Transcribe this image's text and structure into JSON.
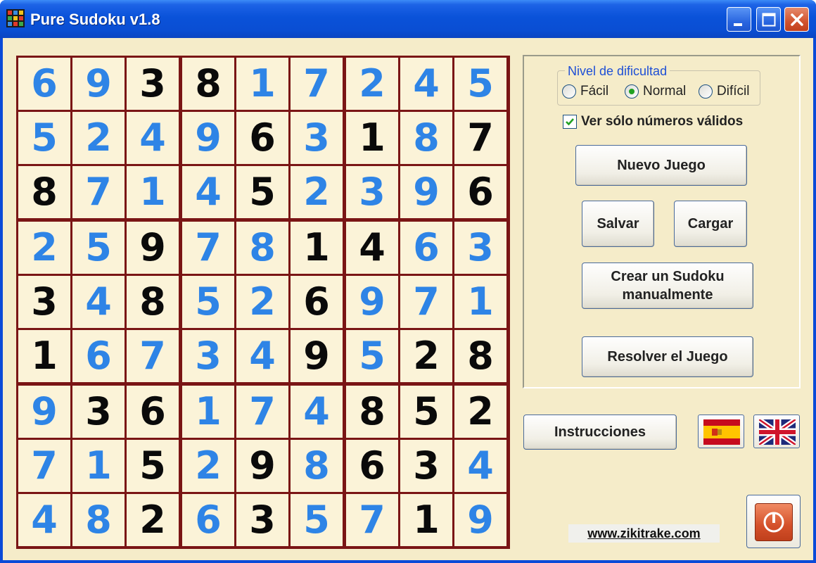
{
  "window": {
    "title": "Pure Sudoku v1.8"
  },
  "board": {
    "rows": [
      [
        {
          "v": "6",
          "c": "blue"
        },
        {
          "v": "9",
          "c": "blue"
        },
        {
          "v": "3",
          "c": "black"
        },
        {
          "v": "8",
          "c": "black"
        },
        {
          "v": "1",
          "c": "blue"
        },
        {
          "v": "7",
          "c": "blue"
        },
        {
          "v": "2",
          "c": "blue"
        },
        {
          "v": "4",
          "c": "blue"
        },
        {
          "v": "5",
          "c": "blue"
        }
      ],
      [
        {
          "v": "5",
          "c": "blue"
        },
        {
          "v": "2",
          "c": "blue"
        },
        {
          "v": "4",
          "c": "blue"
        },
        {
          "v": "9",
          "c": "blue"
        },
        {
          "v": "6",
          "c": "black"
        },
        {
          "v": "3",
          "c": "blue"
        },
        {
          "v": "1",
          "c": "black"
        },
        {
          "v": "8",
          "c": "blue"
        },
        {
          "v": "7",
          "c": "black"
        }
      ],
      [
        {
          "v": "8",
          "c": "black"
        },
        {
          "v": "7",
          "c": "blue"
        },
        {
          "v": "1",
          "c": "blue"
        },
        {
          "v": "4",
          "c": "blue"
        },
        {
          "v": "5",
          "c": "black"
        },
        {
          "v": "2",
          "c": "blue"
        },
        {
          "v": "3",
          "c": "blue"
        },
        {
          "v": "9",
          "c": "blue"
        },
        {
          "v": "6",
          "c": "black"
        }
      ],
      [
        {
          "v": "2",
          "c": "blue"
        },
        {
          "v": "5",
          "c": "blue"
        },
        {
          "v": "9",
          "c": "black"
        },
        {
          "v": "7",
          "c": "blue"
        },
        {
          "v": "8",
          "c": "blue"
        },
        {
          "v": "1",
          "c": "black"
        },
        {
          "v": "4",
          "c": "black"
        },
        {
          "v": "6",
          "c": "blue"
        },
        {
          "v": "3",
          "c": "blue"
        }
      ],
      [
        {
          "v": "3",
          "c": "black"
        },
        {
          "v": "4",
          "c": "blue"
        },
        {
          "v": "8",
          "c": "black"
        },
        {
          "v": "5",
          "c": "blue"
        },
        {
          "v": "2",
          "c": "blue"
        },
        {
          "v": "6",
          "c": "black"
        },
        {
          "v": "9",
          "c": "blue"
        },
        {
          "v": "7",
          "c": "blue"
        },
        {
          "v": "1",
          "c": "blue"
        }
      ],
      [
        {
          "v": "1",
          "c": "black"
        },
        {
          "v": "6",
          "c": "blue"
        },
        {
          "v": "7",
          "c": "blue"
        },
        {
          "v": "3",
          "c": "blue"
        },
        {
          "v": "4",
          "c": "blue"
        },
        {
          "v": "9",
          "c": "black"
        },
        {
          "v": "5",
          "c": "blue"
        },
        {
          "v": "2",
          "c": "black"
        },
        {
          "v": "8",
          "c": "black"
        }
      ],
      [
        {
          "v": "9",
          "c": "blue"
        },
        {
          "v": "3",
          "c": "black"
        },
        {
          "v": "6",
          "c": "black"
        },
        {
          "v": "1",
          "c": "blue"
        },
        {
          "v": "7",
          "c": "blue"
        },
        {
          "v": "4",
          "c": "blue"
        },
        {
          "v": "8",
          "c": "black"
        },
        {
          "v": "5",
          "c": "black"
        },
        {
          "v": "2",
          "c": "black"
        }
      ],
      [
        {
          "v": "7",
          "c": "blue"
        },
        {
          "v": "1",
          "c": "blue"
        },
        {
          "v": "5",
          "c": "black"
        },
        {
          "v": "2",
          "c": "blue"
        },
        {
          "v": "9",
          "c": "black"
        },
        {
          "v": "8",
          "c": "blue"
        },
        {
          "v": "6",
          "c": "black"
        },
        {
          "v": "3",
          "c": "black"
        },
        {
          "v": "4",
          "c": "blue"
        }
      ],
      [
        {
          "v": "4",
          "c": "blue"
        },
        {
          "v": "8",
          "c": "blue"
        },
        {
          "v": "2",
          "c": "black"
        },
        {
          "v": "6",
          "c": "blue"
        },
        {
          "v": "3",
          "c": "black"
        },
        {
          "v": "5",
          "c": "blue"
        },
        {
          "v": "7",
          "c": "blue"
        },
        {
          "v": "1",
          "c": "black"
        },
        {
          "v": "9",
          "c": "blue"
        }
      ]
    ]
  },
  "difficulty": {
    "legend": "Nivel de dificultad",
    "options": [
      {
        "label": "Fácil",
        "selected": false
      },
      {
        "label": "Normal",
        "selected": true
      },
      {
        "label": "Difícil",
        "selected": false
      }
    ]
  },
  "valid_only": {
    "label": "Ver sólo números válidos",
    "checked": true
  },
  "buttons": {
    "new_game": "Nuevo Juego",
    "save": "Salvar",
    "load": "Cargar",
    "create_line1": "Crear un Sudoku",
    "create_line2": "manualmente",
    "solve": "Resolver el Juego",
    "instructions": "Instrucciones"
  },
  "footer": {
    "website": "www.zikitrake.com"
  },
  "colors": {
    "given_digit": "#0a0a0a",
    "user_digit": "#2e84e6",
    "board_border": "#7a1515",
    "cell_background": "#fbf3d8",
    "window_background": "#f5ecc9"
  },
  "icons": [
    "app-icon",
    "minimize-icon",
    "maximize-icon",
    "close-icon",
    "spain-flag-icon",
    "uk-flag-icon",
    "power-icon"
  ]
}
